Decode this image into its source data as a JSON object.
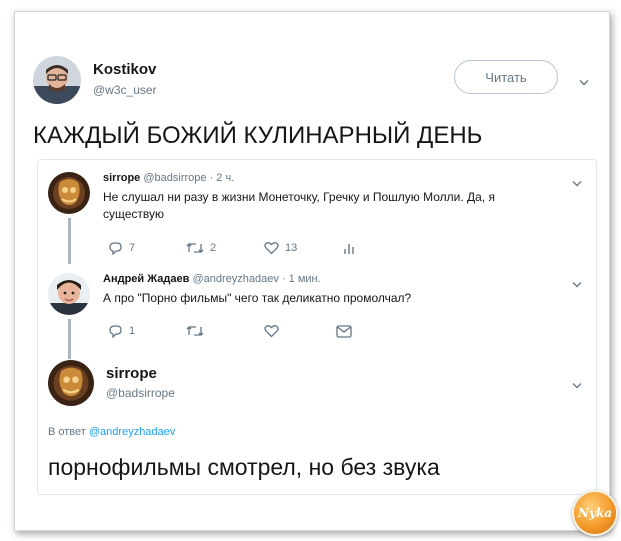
{
  "main_tweet": {
    "author_name": "Kostikov",
    "author_handle": "@w3c_user",
    "follow_label": "Читать",
    "text": "КАЖДЫЙ БОЖИЙ КУЛИНАРНЫЙ ДЕНЬ"
  },
  "quoted": {
    "tweet1": {
      "name": "sirrope",
      "handle": "@badsirrope",
      "time": "· 2 ч.",
      "text": "Не слушал ни разу в жизни Монеточку, Гречку и Пошлую Молли. Да, я существую",
      "reply_count": "7",
      "retweet_count": "2",
      "like_count": "13"
    },
    "tweet2": {
      "name": "Андрей Жадаев",
      "handle": "@andreyzhadaev",
      "time": "· 1 мин.",
      "text": "А про \"Порно фильмы\" чего так деликатно промолчал?",
      "reply_count": "1"
    },
    "tweet3": {
      "name": "sirrope",
      "handle": "@badsirrope",
      "reply_prefix": "В ответ",
      "reply_to": "@andreyzhadaev",
      "text": "порнофильмы смотрел, но без звука"
    }
  },
  "watermark": {
    "label": "Nyka"
  },
  "colors": {
    "link": "#1da1f2",
    "muted": "#657786",
    "text": "#14171a",
    "thread_line": "#aab8c2"
  }
}
